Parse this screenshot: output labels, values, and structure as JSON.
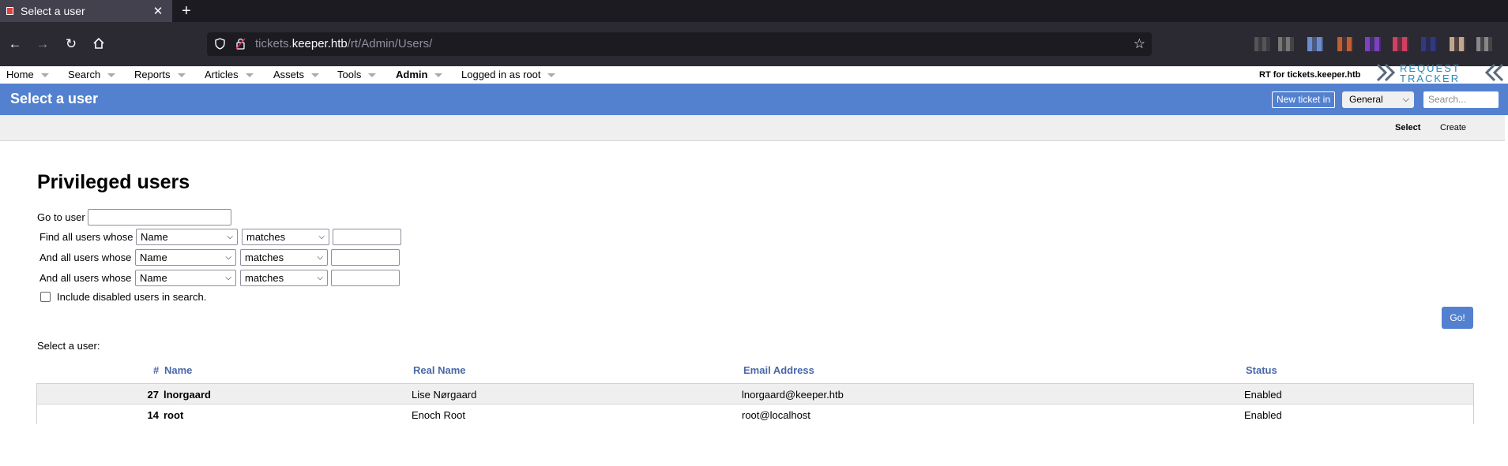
{
  "browser": {
    "tab_title": "Select a user",
    "url_host_prefix": "tickets.",
    "url_host": "keeper.htb",
    "url_path": "/rt/Admin/Users/"
  },
  "topmenu": {
    "items": [
      "Home",
      "Search",
      "Reports",
      "Articles",
      "Assets",
      "Tools",
      "Admin",
      "Logged in as root"
    ],
    "rt_for": "RT for tickets.keeper.htb",
    "logo_line1": "REQUEST",
    "logo_line2": "TRACKER"
  },
  "header": {
    "title": "Select a user",
    "new_ticket_label": "New ticket in",
    "queue_selected": "General",
    "search_placeholder": "Search..."
  },
  "submenu": {
    "select_label": "Select",
    "create_label": "Create"
  },
  "main": {
    "heading": "Privileged users",
    "goto_label": "Go to user",
    "find_label": "Find all users whose",
    "and_label": "And all users whose",
    "field_option": "Name",
    "op_option": "matches",
    "include_disabled_label": "Include disabled users in search.",
    "go_label": "Go!",
    "select_user_label": "Select a user:"
  },
  "table": {
    "columns": {
      "num": "#",
      "name": "Name",
      "realname": "Real Name",
      "email": "Email Address",
      "status": "Status"
    },
    "rows": [
      {
        "id": "27",
        "name": "lnorgaard",
        "realname": "Lise Nørgaard",
        "email": "lnorgaard@keeper.htb",
        "status": "Enabled"
      },
      {
        "id": "14",
        "name": "root",
        "realname": "Enoch Root",
        "email": "root@localhost",
        "status": "Enabled"
      }
    ]
  }
}
